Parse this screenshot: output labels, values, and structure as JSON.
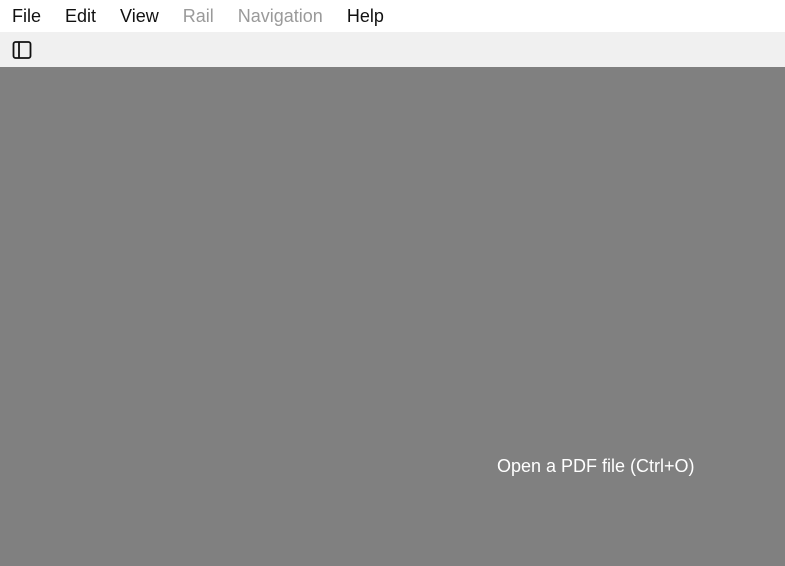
{
  "menubar": {
    "items": [
      {
        "label": "File",
        "enabled": true
      },
      {
        "label": "Edit",
        "enabled": true
      },
      {
        "label": "View",
        "enabled": true
      },
      {
        "label": "Rail",
        "enabled": false
      },
      {
        "label": "Navigation",
        "enabled": false
      },
      {
        "label": "Help",
        "enabled": true
      }
    ]
  },
  "toolbar": {
    "sidebar_toggle_icon": "sidebar-panel-icon"
  },
  "viewer": {
    "hint": "Open a PDF file (Ctrl+O)",
    "background_color": "#808080"
  }
}
